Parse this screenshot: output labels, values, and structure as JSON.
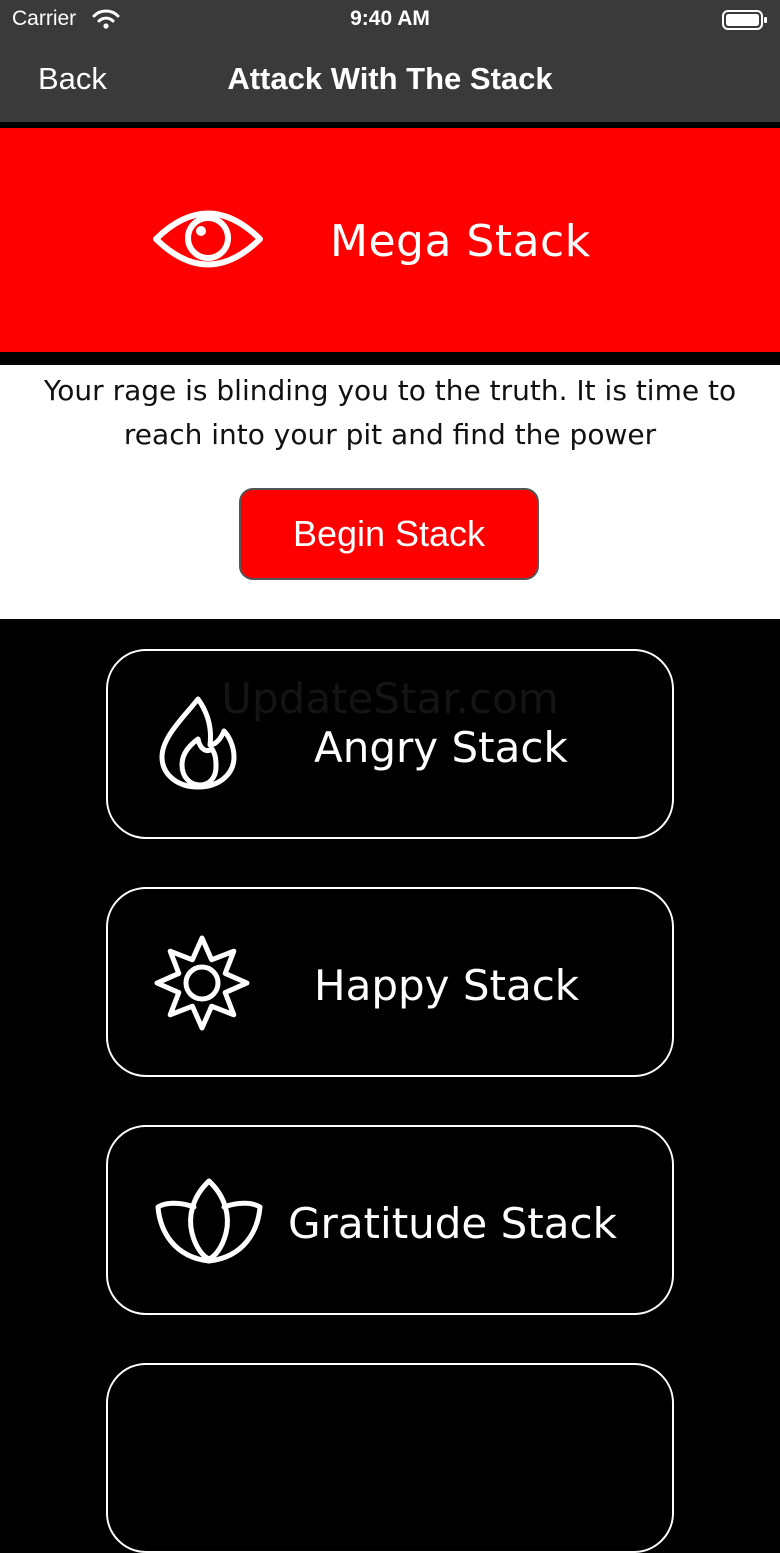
{
  "status_bar": {
    "carrier": "Carrier",
    "time": "9:40 AM",
    "icons": [
      "wifi-icon",
      "battery-icon"
    ]
  },
  "nav": {
    "back_label": "Back",
    "title": "Attack With The Stack"
  },
  "hero": {
    "icon": "eye-icon",
    "title": "Mega Stack",
    "color": "#ff0000"
  },
  "info": {
    "description": "Your rage is blinding you to the truth. It is time to reach into your pit and find the power",
    "button_label": "Begin Stack"
  },
  "watermark": "UpdateStar.com",
  "stacks": [
    {
      "icon": "flame-icon",
      "label": "Angry Stack"
    },
    {
      "icon": "sun-icon",
      "label": "Happy Stack"
    },
    {
      "icon": "lotus-icon",
      "label": "Gratitude Stack"
    }
  ],
  "colors": {
    "header": "#3a3a3a",
    "accent": "#ff0000",
    "background": "#000000"
  }
}
